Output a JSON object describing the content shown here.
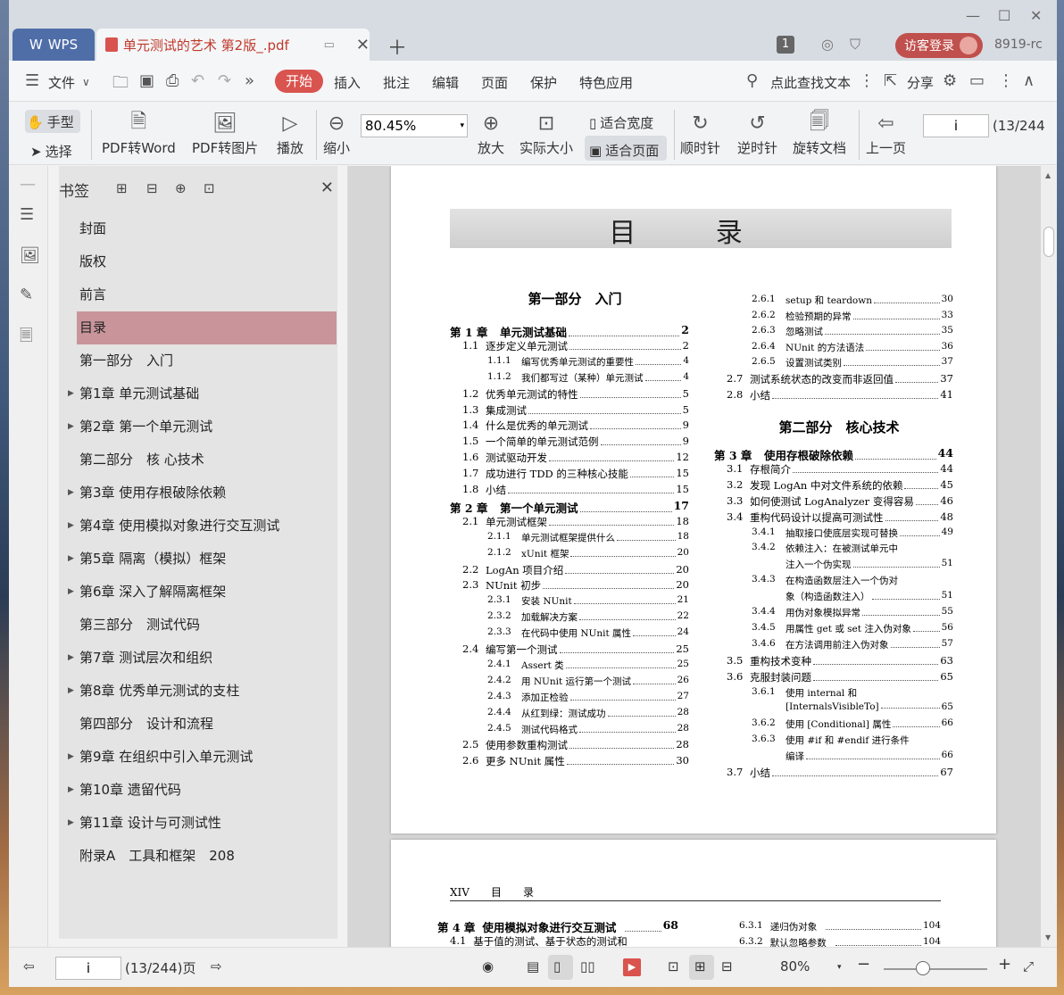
{
  "window": {
    "minimize": "—",
    "maximize": "☐",
    "close": "✕"
  },
  "tabs": {
    "app": "WPS",
    "doc_title": "单元测试的艺术 第2版_.pdf"
  },
  "titlebar": {
    "count": "1",
    "login": "访客登录",
    "user_id": "8919-rc"
  },
  "menu": {
    "file": "文件",
    "start": "开始",
    "items": [
      "插入",
      "批注",
      "编辑",
      "页面",
      "保护",
      "特色应用"
    ],
    "search": "点此查找文本",
    "share": "分享"
  },
  "toolbar": {
    "hand": "手型",
    "select": "选择",
    "pdf_word": "PDF转Word",
    "pdf_image": "PDF转图片",
    "play": "播放",
    "zoom_out": "缩小",
    "zoom_value": "80.45%",
    "zoom_in": "放大",
    "actual_size": "实际大小",
    "fit_width": "适合宽度",
    "fit_page": "适合页面",
    "rotate_cw": "顺时针",
    "rotate_ccw": "逆时针",
    "rotate_doc": "旋转文档",
    "prev_page": "上一页",
    "page_value": "i",
    "page_count": "(13/244"
  },
  "bookmarks": {
    "title": "书签",
    "items": [
      {
        "label": "封面",
        "arrow": false
      },
      {
        "label": "版权",
        "arrow": false
      },
      {
        "label": "前言",
        "arrow": false
      },
      {
        "label": "目录",
        "arrow": false,
        "selected": true
      },
      {
        "label": "第一部分　入门",
        "arrow": false
      },
      {
        "label": "第1章 单元测试基础",
        "arrow": true
      },
      {
        "label": "第2章 第一个单元测试",
        "arrow": true
      },
      {
        "label": "第二部分　核 心技术",
        "arrow": false
      },
      {
        "label": "第3章 使用存根破除依赖",
        "arrow": true
      },
      {
        "label": "第4章 使用模拟对象进行交互测试",
        "arrow": true
      },
      {
        "label": "第5章 隔离（模拟）框架",
        "arrow": true
      },
      {
        "label": "第6章 深入了解隔离框架",
        "arrow": true
      },
      {
        "label": "第三部分　测试代码",
        "arrow": false
      },
      {
        "label": "第7章 测试层次和组织",
        "arrow": true
      },
      {
        "label": "第8章 优秀单元测试的支柱",
        "arrow": true
      },
      {
        "label": "第四部分　设计和流程",
        "arrow": false
      },
      {
        "label": "第9章 在组织中引入单元测试",
        "arrow": true
      },
      {
        "label": "第10章 遗留代码",
        "arrow": true
      },
      {
        "label": "第11章 设计与可测试性",
        "arrow": true
      },
      {
        "label": "附录A　工具和框架　208",
        "arrow": false
      }
    ]
  },
  "page1": {
    "title": "目 录",
    "part1": "第一部分　入门",
    "part2": "第二部分　核心技术",
    "left": [
      {
        "n": "第 1 章",
        "t": "单元测试基础",
        "p": "2",
        "lvl": 0
      },
      {
        "n": "1.1",
        "t": "逐步定义单元测试",
        "p": "2",
        "lvl": 1
      },
      {
        "n": "1.1.1",
        "t": "编写优秀单元测试的重要性",
        "p": "4",
        "lvl": 2
      },
      {
        "n": "1.1.2",
        "t": "我们都写过（某种）单元测试",
        "p": "4",
        "lvl": 2
      },
      {
        "n": "1.2",
        "t": "优秀单元测试的特性",
        "p": "5",
        "lvl": 1
      },
      {
        "n": "1.3",
        "t": "集成测试",
        "p": "5",
        "lvl": 1
      },
      {
        "n": "1.4",
        "t": "什么是优秀的单元测试",
        "p": "9",
        "lvl": 1
      },
      {
        "n": "1.5",
        "t": "一个简单的单元测试范例",
        "p": "9",
        "lvl": 1
      },
      {
        "n": "1.6",
        "t": "测试驱动开发",
        "p": "12",
        "lvl": 1
      },
      {
        "n": "1.7",
        "t": "成功进行 TDD 的三种核心技能",
        "p": "15",
        "lvl": 1
      },
      {
        "n": "1.8",
        "t": "小结",
        "p": "15",
        "lvl": 1
      },
      {
        "n": "第 2 章",
        "t": "第一个单元测试",
        "p": "17",
        "lvl": 0
      },
      {
        "n": "2.1",
        "t": "单元测试框架",
        "p": "18",
        "lvl": 1
      },
      {
        "n": "2.1.1",
        "t": "单元测试框架提供什么",
        "p": "18",
        "lvl": 2
      },
      {
        "n": "2.1.2",
        "t": "xUnit 框架",
        "p": "20",
        "lvl": 2
      },
      {
        "n": "2.2",
        "t": "LogAn 项目介绍",
        "p": "20",
        "lvl": 1
      },
      {
        "n": "2.3",
        "t": "NUnit 初步",
        "p": "20",
        "lvl": 1
      },
      {
        "n": "2.3.1",
        "t": "安装 NUnit",
        "p": "21",
        "lvl": 2
      },
      {
        "n": "2.3.2",
        "t": "加载解决方案",
        "p": "22",
        "lvl": 2
      },
      {
        "n": "2.3.3",
        "t": "在代码中使用 NUnit 属性",
        "p": "24",
        "lvl": 2
      },
      {
        "n": "2.4",
        "t": "编写第一个测试",
        "p": "25",
        "lvl": 1
      },
      {
        "n": "2.4.1",
        "t": "Assert 类",
        "p": "25",
        "lvl": 2
      },
      {
        "n": "2.4.2",
        "t": "用 NUnit 运行第一个测试",
        "p": "26",
        "lvl": 2
      },
      {
        "n": "2.4.3",
        "t": "添加正检验",
        "p": "27",
        "lvl": 2
      },
      {
        "n": "2.4.4",
        "t": "从红到绿：测试成功",
        "p": "28",
        "lvl": 2
      },
      {
        "n": "2.4.5",
        "t": "测试代码格式",
        "p": "28",
        "lvl": 2
      },
      {
        "n": "2.5",
        "t": "使用参数重构测试",
        "p": "28",
        "lvl": 1
      },
      {
        "n": "2.6",
        "t": "更多 NUnit 属性",
        "p": "30",
        "lvl": 1
      }
    ],
    "right_top": [
      {
        "n": "2.6.1",
        "t": "setup 和 teardown",
        "p": "30",
        "lvl": 2
      },
      {
        "n": "2.6.2",
        "t": "检验预期的异常",
        "p": "33",
        "lvl": 2
      },
      {
        "n": "2.6.3",
        "t": "忽略测试",
        "p": "35",
        "lvl": 2
      },
      {
        "n": "2.6.4",
        "t": "NUnit 的方法语法",
        "p": "36",
        "lvl": 2
      },
      {
        "n": "2.6.5",
        "t": "设置测试类别",
        "p": "37",
        "lvl": 2
      },
      {
        "n": "2.7",
        "t": "测试系统状态的改变而非返回值",
        "p": "37",
        "lvl": 1
      },
      {
        "n": "2.8",
        "t": "小结",
        "p": "41",
        "lvl": 1
      }
    ],
    "right_bottom": [
      {
        "n": "第 3 章",
        "t": "使用存根破除依赖",
        "p": "44",
        "lvl": 0
      },
      {
        "n": "3.1",
        "t": "存根简介",
        "p": "44",
        "lvl": 1
      },
      {
        "n": "3.2",
        "t": "发现 LogAn 中对文件系统的依赖",
        "p": "45",
        "lvl": 1
      },
      {
        "n": "3.3",
        "t": "如何使测试 LogAnalyzer 变得容易",
        "p": "46",
        "lvl": 1
      },
      {
        "n": "3.4",
        "t": "重构代码设计以提高可测试性",
        "p": "48",
        "lvl": 1
      },
      {
        "n": "3.4.1",
        "t": "抽取接口使底层实现可替换",
        "p": "49",
        "lvl": 2
      },
      {
        "n": "3.4.2",
        "t": "依赖注入：在被测试单元中",
        "p": "",
        "lvl": 2
      },
      {
        "n": "",
        "t": "注入一个伪实现",
        "p": "51",
        "lvl": 2
      },
      {
        "n": "3.4.3",
        "t": "在构造函数层注入一个伪对",
        "p": "",
        "lvl": 2
      },
      {
        "n": "",
        "t": "象（构造函数注入）",
        "p": "51",
        "lvl": 2
      },
      {
        "n": "3.4.4",
        "t": "用伪对象模拟异常",
        "p": "55",
        "lvl": 2
      },
      {
        "n": "3.4.5",
        "t": "用属性 get 或 set 注入伪对象",
        "p": "56",
        "lvl": 2
      },
      {
        "n": "3.4.6",
        "t": "在方法调用前注入伪对象",
        "p": "57",
        "lvl": 2
      },
      {
        "n": "3.5",
        "t": "重构技术变种",
        "p": "63",
        "lvl": 1
      },
      {
        "n": "3.6",
        "t": "克服封装问题",
        "p": "65",
        "lvl": 1
      },
      {
        "n": "3.6.1",
        "t": "使用 internal 和",
        "p": "",
        "lvl": 2
      },
      {
        "n": "",
        "t": "[InternalsVisibleTo]",
        "p": "65",
        "lvl": 2
      },
      {
        "n": "3.6.2",
        "t": "使用 [Conditional] 属性",
        "p": "66",
        "lvl": 2
      },
      {
        "n": "3.6.3",
        "t": "使用 #if 和 #endif 进行条件",
        "p": "",
        "lvl": 2
      },
      {
        "n": "",
        "t": "编译",
        "p": "66",
        "lvl": 2
      },
      {
        "n": "3.7",
        "t": "小结",
        "p": "67",
        "lvl": 1
      }
    ]
  },
  "page2": {
    "header": "XIV　　目　　录",
    "left": [
      {
        "n": "第 4 章",
        "t": "使用模拟对象进行交互测试",
        "p": "68"
      },
      {
        "n": "4.1",
        "t": "基于值的测试、基于状态的测试和",
        "p": ""
      }
    ],
    "right": [
      {
        "n": "6.3.1",
        "t": "递归伪对象",
        "p": "104"
      },
      {
        "n": "6.3.2",
        "t": "默认忽略参数",
        "p": "104"
      }
    ]
  },
  "statusbar": {
    "page_value": "i",
    "page_count": "(13/244)页",
    "zoom": "80%"
  }
}
